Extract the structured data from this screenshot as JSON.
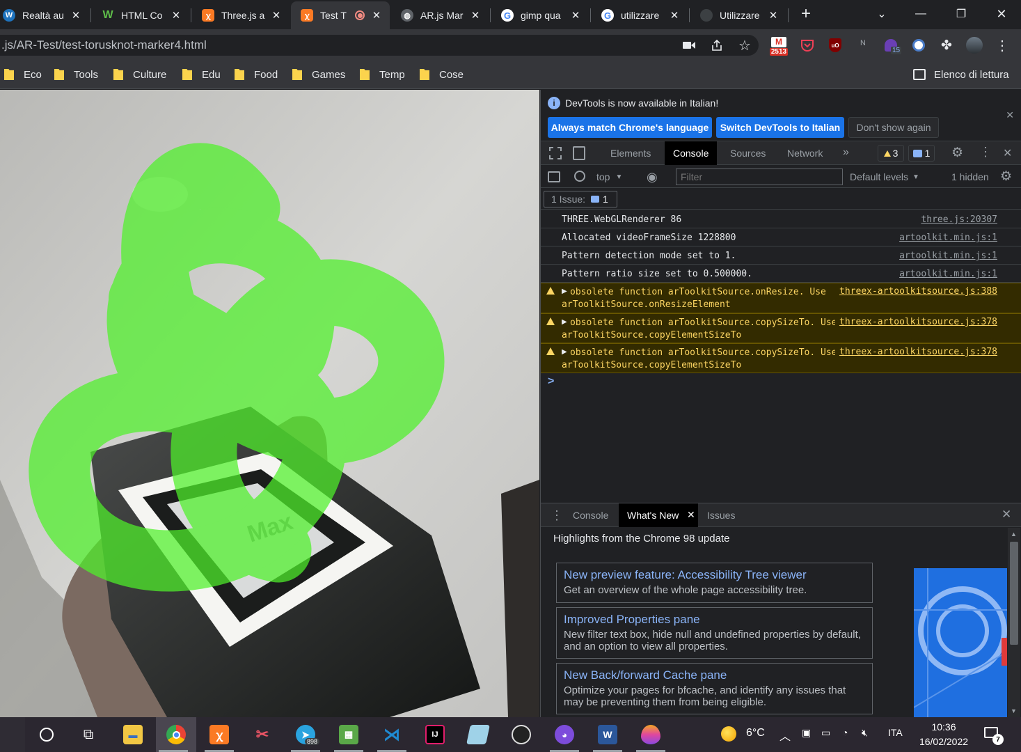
{
  "browser": {
    "tabs": [
      {
        "title": "Realtà au",
        "favicon": "wordpress-icon",
        "color": "#1e73be"
      },
      {
        "title": "HTML Co",
        "favicon": "w-icon",
        "color": "#202124"
      },
      {
        "title": "Three.js a",
        "favicon": "xampp-icon",
        "color": "#fb7a24"
      },
      {
        "title": "Test T",
        "favicon": "xampp-icon",
        "color": "#fb7a24",
        "active": true,
        "recording": true
      },
      {
        "title": "AR.js Mar",
        "favicon": "globe-icon",
        "color": "#5f6368"
      },
      {
        "title": "gimp qua",
        "favicon": "google-icon",
        "color": "#ffffff"
      },
      {
        "title": "utilizzare",
        "favicon": "google-icon",
        "color": "#ffffff"
      },
      {
        "title": "Utilizzare",
        "favicon": "loading-icon",
        "color": "#5f6368"
      }
    ],
    "new_tab": "+",
    "url": ".js/AR-Test/test-torusknot-marker4.html",
    "gmail_count": "2513",
    "ext_badge": "15",
    "bookmarks": [
      "Eco",
      "Tools",
      "Culture",
      "Edu",
      "Food",
      "Games",
      "Temp",
      "Cose"
    ],
    "reading_list": "Elenco di lettura"
  },
  "viewport": {
    "marker_text": "Max"
  },
  "devtools": {
    "banner": {
      "text": "DevTools is now available in Italian!",
      "buttons": [
        "Always match Chrome's language",
        "Switch DevTools to Italian",
        "Don't show again"
      ]
    },
    "tabs": [
      "Elements",
      "Console",
      "Sources",
      "Network"
    ],
    "active_tab": "Console",
    "warning_count": "3",
    "message_count": "1",
    "console_toolbar": {
      "context": "top",
      "filter_placeholder": "Filter",
      "levels": "Default levels",
      "hidden": "1 hidden"
    },
    "issues": {
      "label": "1 Issue:",
      "count": "1"
    },
    "logs": [
      {
        "msg": "THREE.WebGLRenderer 86",
        "src": "three.js:20307",
        "level": "info"
      },
      {
        "msg": "Allocated videoFrameSize 1228800",
        "src": "artoolkit.min.js:1",
        "level": "info"
      },
      {
        "msg": "Pattern detection mode set to 1.",
        "src": "artoolkit.min.js:1",
        "level": "info"
      },
      {
        "msg": "Pattern ratio size set to 0.500000.",
        "src": "artoolkit.min.js:1",
        "level": "info"
      },
      {
        "msg": "obsolete function arToolkitSource.onResize. Use arToolkitSource.onResizeElement",
        "src": "threex-artoolkitsource.js:388",
        "level": "warn"
      },
      {
        "msg": "obsolete function arToolkitSource.copySizeTo. Use arToolkitSource.copyElementSizeTo",
        "src": "threex-artoolkitsource.js:378",
        "level": "warn"
      },
      {
        "msg": "obsolete function arToolkitSource.copySizeTo. Use arToolkitSource.copyElementSizeTo",
        "src": "threex-artoolkitsource.js:378",
        "level": "warn"
      }
    ],
    "prompt": ">",
    "drawer": {
      "tabs": [
        "Console",
        "What's New",
        "Issues"
      ],
      "active_tab": "What's New",
      "heading": "Highlights from the Chrome 98 update",
      "cards": [
        {
          "title": "New preview feature: Accessibility Tree viewer",
          "desc": "Get an overview of the whole page accessibility tree."
        },
        {
          "title": "Improved Properties pane",
          "desc": "New filter text box, hide null and undefined properties by default, and an option to view all properties."
        },
        {
          "title": "New Back/forward Cache pane",
          "desc": "Optimize your pages for bfcache, and identify any issues that may be preventing them from being eligible."
        }
      ]
    }
  },
  "taskbar": {
    "apps": [
      {
        "name": "file-explorer-icon",
        "color": "#f2c744"
      },
      {
        "name": "chrome-icon",
        "color": "#4285f4",
        "running": true,
        "active": true
      },
      {
        "name": "xampp-icon",
        "color": "#fb7a24",
        "running": true
      },
      {
        "name": "snipping-tool-icon",
        "color": "#e56"
      },
      {
        "name": "telegram-icon",
        "color": "#2aa3df",
        "running": true,
        "badge": "898"
      },
      {
        "name": "paint-icon",
        "color": "#5aa848",
        "running": true
      },
      {
        "name": "vscode-icon",
        "color": "#1f8ad2",
        "running": true
      },
      {
        "name": "intellij-icon",
        "color": "#e11d6b"
      },
      {
        "name": "paint3d-icon",
        "color": "#9fd2e8"
      },
      {
        "name": "obs-icon",
        "color": "#333"
      },
      {
        "name": "github-icon",
        "color": "#7d4cdb",
        "running": true
      },
      {
        "name": "word-icon",
        "color": "#2b579a",
        "running": true
      },
      {
        "name": "paint-drop-icon",
        "color": "#c548e0",
        "running": true
      }
    ],
    "weather": "6°C",
    "language": "ITA",
    "time": "10:36",
    "date": "16/02/2022",
    "notifications": "7"
  }
}
